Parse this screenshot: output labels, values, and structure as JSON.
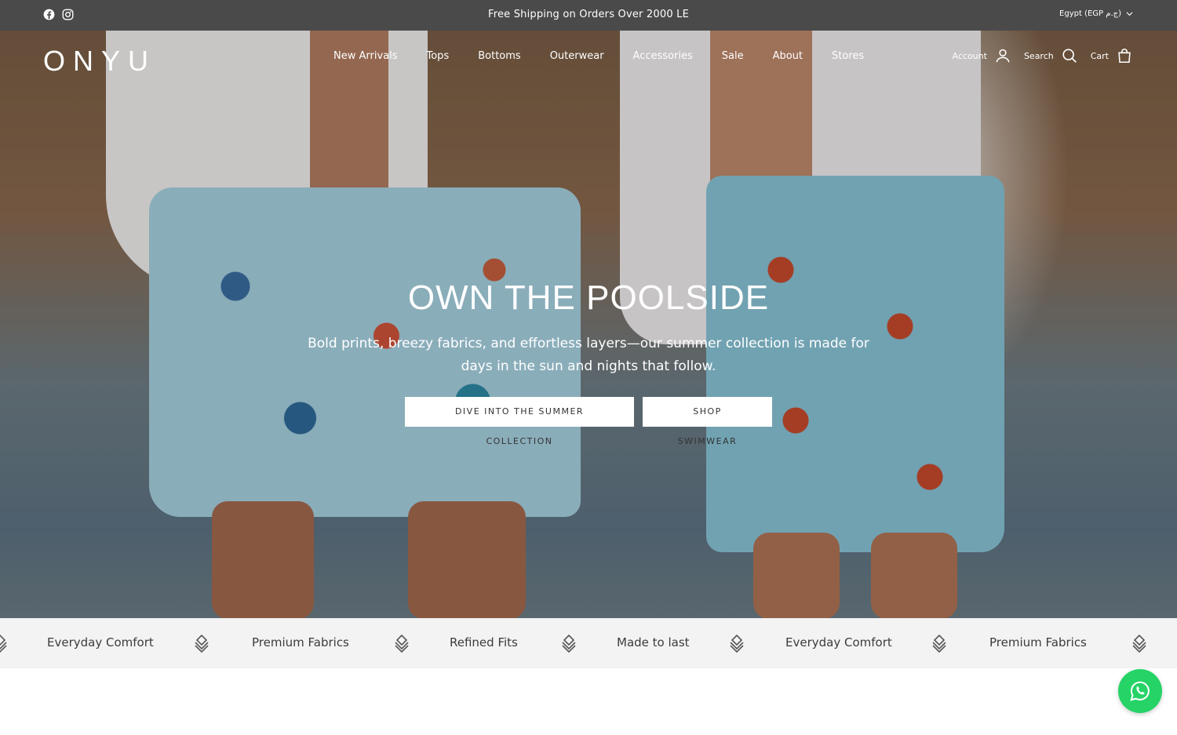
{
  "announcement": {
    "message": "Free Shipping on Orders Over 2000 LE",
    "locale": "Egypt (EGP ج.م)",
    "social": [
      "facebook-icon",
      "instagram-icon"
    ]
  },
  "header": {
    "logo": "ONYU",
    "nav": [
      "New Arrivals",
      "Tops",
      "Bottoms",
      "Outerwear",
      "Accessories",
      "Sale",
      "About",
      "Stores"
    ],
    "account_label": "Account",
    "search_label": "Search",
    "cart_label": "Cart"
  },
  "hero": {
    "title": "OWN THE POOLSIDE",
    "subtitle": "Bold prints, breezy fabrics, and effortless layers—our summer collection is made for days in the sun and nights that follow.",
    "cta_primary": "DIVE INTO THE SUMMER COLLECTION",
    "cta_secondary": "SHOP SWIMWEAR"
  },
  "marquee": {
    "items": [
      "Everyday Comfort",
      "Premium Fabrics",
      "Refined Fits",
      "Made to last",
      "Everyday Comfort",
      "Premium Fabrics"
    ]
  },
  "colors": {
    "announcement_bg": "#4b4a4b",
    "marquee_bg": "#f3f3f3",
    "whatsapp": "#25d366"
  }
}
